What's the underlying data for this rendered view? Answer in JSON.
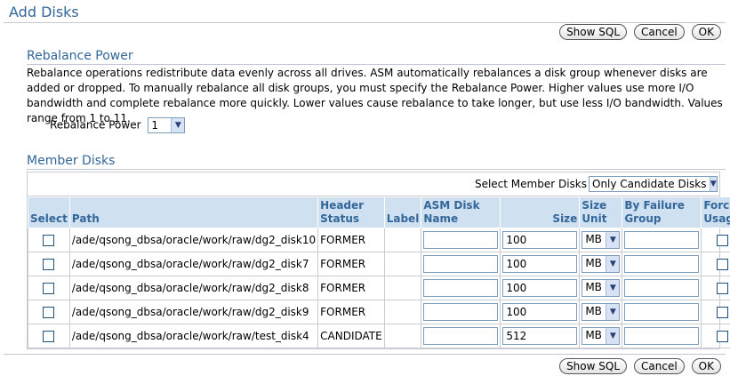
{
  "page": {
    "title": "Add Disks"
  },
  "buttons": {
    "show_sql": "Show SQL",
    "cancel": "Cancel",
    "ok": "OK"
  },
  "rebalance": {
    "title": "Rebalance Power",
    "description": "Rebalance operations redistribute data evenly across all drives. ASM automatically rebalances a disk group whenever disks are added or dropped. To manually rebalance all disk groups, you must specify the Rebalance Power. Higher values use more I/O bandwidth and complete rebalance more quickly. Lower values cause rebalance to take longer, but use less I/O bandwidth. Values range from 1 to 11.",
    "power_label": "Rebalance Power",
    "power_value": "1"
  },
  "member_disks": {
    "title": "Member Disks",
    "filter_label": "Select Member Disks",
    "filter_value": "Only Candidate Disks",
    "columns": {
      "select": "Select",
      "path": "Path",
      "header_status": "Header Status",
      "label": "Label",
      "asm_disk_name": "ASM Disk Name",
      "size": "Size",
      "size_unit": "Size Unit",
      "failure_group": "By Failure Group",
      "force_usage": "Force Usage"
    },
    "rows": [
      {
        "path": "/ade/qsong_dbsa/oracle/work/raw/dg2_disk10",
        "status": "FORMER",
        "label": "",
        "asm_name": "",
        "size": "100",
        "unit": "MB",
        "failure_group": ""
      },
      {
        "path": "/ade/qsong_dbsa/oracle/work/raw/dg2_disk7",
        "status": "FORMER",
        "label": "",
        "asm_name": "",
        "size": "100",
        "unit": "MB",
        "failure_group": ""
      },
      {
        "path": "/ade/qsong_dbsa/oracle/work/raw/dg2_disk8",
        "status": "FORMER",
        "label": "",
        "asm_name": "",
        "size": "100",
        "unit": "MB",
        "failure_group": ""
      },
      {
        "path": "/ade/qsong_dbsa/oracle/work/raw/dg2_disk9",
        "status": "FORMER",
        "label": "",
        "asm_name": "",
        "size": "100",
        "unit": "MB",
        "failure_group": ""
      },
      {
        "path": "/ade/qsong_dbsa/oracle/work/raw/test_disk4",
        "status": "CANDIDATE",
        "label": "",
        "asm_name": "",
        "size": "512",
        "unit": "MB",
        "failure_group": ""
      }
    ]
  },
  "icons": {
    "dropdown": "chevron-down-icon",
    "checkbox": "checkbox-unchecked"
  },
  "colors": {
    "heading": "#336699",
    "table_header_bg": "#cfe0f1",
    "dropdown_arrow_bg": "#d7e2f5"
  }
}
